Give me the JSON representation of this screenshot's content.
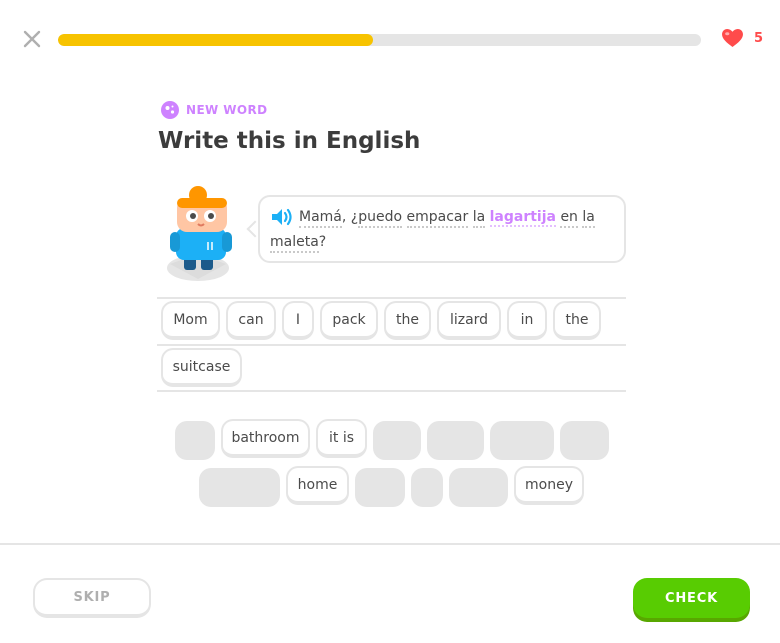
{
  "header": {
    "progress_percent": 49,
    "hearts_count": "5"
  },
  "prompt": {
    "badge_label": "NEW WORD",
    "title": "Write this in English"
  },
  "sentence": {
    "words": [
      "Mamá",
      ", ¿",
      "puedo",
      " ",
      "empacar",
      " ",
      "la",
      " ",
      "lagartija",
      " ",
      "en",
      " ",
      "la",
      " ",
      "maleta",
      "?"
    ]
  },
  "answer": {
    "tiles": [
      "Mom",
      "can",
      "I",
      "pack",
      "the",
      "lizard",
      "in",
      "the",
      "suitcase"
    ]
  },
  "word_bank": {
    "tiles": [
      "bathroom",
      "it is",
      "home",
      "money"
    ]
  },
  "footer": {
    "skip_label": "SKIP",
    "check_label": "CHECK"
  },
  "colors": {
    "progress": "#f7c300",
    "heart": "#ff4b4b",
    "new_word": "#ce82ff",
    "check": "#58cc02"
  }
}
